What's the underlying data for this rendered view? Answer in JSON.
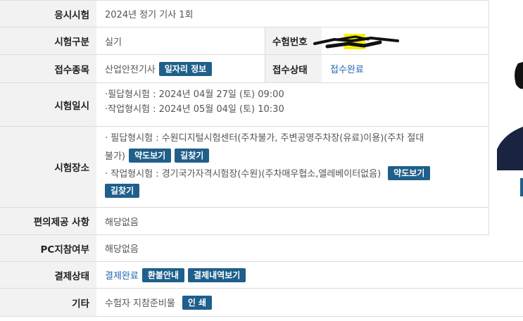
{
  "exam_name": {
    "label": "응시시험",
    "value": "2024년 정기 기사 1회"
  },
  "exam_type": {
    "label": "시험구분",
    "value": "실기",
    "number_label": "수험번호",
    "number_value": ""
  },
  "category": {
    "label": "접수종목",
    "value": "산업안전기사",
    "job_button": "일자리 정보",
    "status_label": "접수상태",
    "status_value": "접수완료"
  },
  "schedule": {
    "label": "시험일시",
    "lines": [
      "·필답형시험 : 2024년 04월 27일 (토) 09:00",
      "·작업형시험 : 2024년 05월 04일 (토) 10:30"
    ]
  },
  "venue": {
    "label": "시험장소",
    "written_line1": "· 필답형시험 : 수원디지털시험센터(주차불가, 주변공영주차장(유료)이용)(주차 절대",
    "written_line2": "불가)",
    "practical_line1": "· 작업형시험 : 경기국가자격시험장(수원)(주차매우협소,엘레베이터없음)",
    "map_button": "약도보기",
    "route_button": "길찾기"
  },
  "convenience": {
    "label": "편의제공 사항",
    "value": "해당없음"
  },
  "pc_bring": {
    "label": "PC지참여부",
    "value": "해당없음"
  },
  "payment": {
    "label": "결제상태",
    "value": "결제완료",
    "refund_button": "환불안내",
    "history_button": "결제내역보기"
  },
  "etc": {
    "label": "기타",
    "value": "수험자 지참준비물",
    "print_button": "인 쇄"
  },
  "colors": {
    "header_bg": "#f2f2f2",
    "button": "#1f5f8b",
    "link": "#1f66b0",
    "highlight": "#f5f000"
  }
}
